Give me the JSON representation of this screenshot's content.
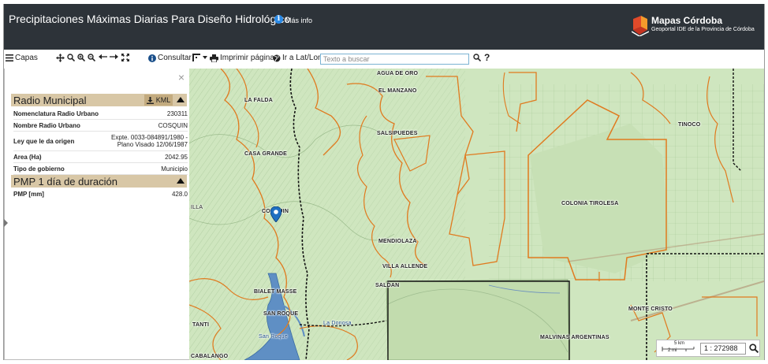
{
  "header": {
    "title": "Precipitaciones Máximas Diarias Para Diseño Hidrológico",
    "info_label": "Más info",
    "brand_name": "Mapas Córdoba",
    "brand_sub": "Geoportal IDE de la Provincia de Córdoba"
  },
  "toolbar": {
    "layers_label": "Capas",
    "query_label": "Consultar",
    "print_label": "Imprimir página",
    "latlon_label": "Ir a Lat/Lon",
    "search_placeholder": "Texto a buscar",
    "help_label": "?"
  },
  "panel": {
    "close_label": "×",
    "section1": {
      "title": "Radio Municipal",
      "kml_label": "KML",
      "rows": [
        {
          "key": "Nomenclatura Radio Urbano",
          "value": "230311"
        },
        {
          "key": "Nombre Radio Urbano",
          "value": "COSQUIN"
        },
        {
          "key": "Ley que le da origen",
          "value": "Expte. 0033-084891/1980 - Plano Visado 12/06/1987"
        },
        {
          "key": "Area (Ha)",
          "value": "2042.95"
        },
        {
          "key": "Tipo de gobierno",
          "value": "Municipio"
        }
      ]
    },
    "section2": {
      "title": "PMP 1 día de duración",
      "rows": [
        {
          "key": "PMP [mm]",
          "value": "428.0"
        }
      ]
    }
  },
  "map": {
    "labels": {
      "agua_de_oro": "AGUA DE ORO",
      "la_falda": "LA FALDA",
      "el_manzano": "EL MANZANO",
      "tinoco": "TINOCO",
      "salsipuedes": "SALSIPUEDES",
      "casa_grande": "CASA GRANDE",
      "cosquin": "COSQUIN",
      "colonia_tirolesa": "COLONIA TIROLESA",
      "illa": "ILLA",
      "mendiolaza": "MENDIOLAZA",
      "villa_allende": "VILLA ALLENDE",
      "saldan": "SALDAN",
      "bialet_masse": "BIALET MASSE",
      "san_roque": "SAN ROQUE",
      "tanti": "TANTI",
      "monte_cristo": "MONTE CRISTO",
      "malvinas_argentinas": "MALVINAS ARGENTINAS",
      "cabalango": "CABALANGO",
      "lake": "San Roque",
      "la_donosa": "La Donosa"
    },
    "scale": {
      "km_label": "5 km",
      "mi_label": "2 mi",
      "ratio": "1 : 272988"
    }
  },
  "colors": {
    "header_bg": "#2d3339",
    "panel_section": "#d8c7a6",
    "boundary": "#e07a1f",
    "map_bg": "#cfe6bf"
  }
}
